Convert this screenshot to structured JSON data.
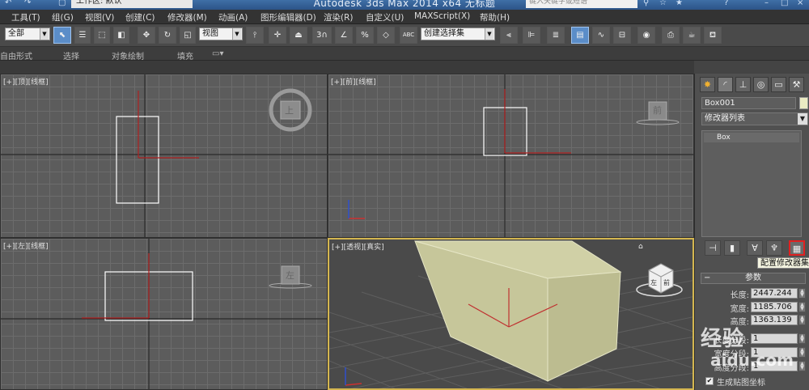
{
  "title_bar": {
    "title": "Autodesk 3ds Max  2014 x64     无标题",
    "workspace": "工作区: 默认",
    "search_placeholder": "键入关键字或短语"
  },
  "menu": [
    "工具(T)",
    "组(G)",
    "视图(V)",
    "创建(C)",
    "修改器(M)",
    "动画(A)",
    "图形编辑器(D)",
    "渲染(R)",
    "自定义(U)",
    "MAXScript(X)",
    "帮助(H)"
  ],
  "toolbar": {
    "selection_filter": "全部",
    "reference_coord": "视图",
    "named_selection": "创建选择集",
    "snap_3": "3",
    "angle_snap": "∠",
    "percent_snap": "%",
    "spinner_snap": "◇",
    "abc": "ABC"
  },
  "ribbon": {
    "items": [
      "自由形式",
      "选择",
      "对象绘制",
      "填充"
    ]
  },
  "viewports": {
    "top_left": {
      "label": "[+][顶][线框]"
    },
    "top_right": {
      "label": "[+][前][线框]"
    },
    "bottom_left": {
      "label": "[+][左][线框]"
    },
    "bottom_right": {
      "label": "[+][透视][真实]"
    },
    "viewcube_top": "上",
    "viewcube_front": "前",
    "viewcube_left": "左",
    "viewcube_persp_left": "左",
    "viewcube_persp_front": "前"
  },
  "command_panel": {
    "object_name": "Box001",
    "modifier_list": "修改器列表",
    "stack_item": "Box",
    "tooltip": "配置修改器集",
    "rollout_title": "参数",
    "params": [
      {
        "label": "长度:",
        "value": "2447.244"
      },
      {
        "label": "宽度:",
        "value": "1185.706"
      },
      {
        "label": "高度:",
        "value": "1363.139"
      },
      {
        "label": "长度分段:",
        "value": "1"
      },
      {
        "label": "宽度分段:",
        "value": "1"
      },
      {
        "label": "高度分段:",
        "value": "1"
      }
    ],
    "generate_mapping": "生成贴图坐标",
    "object_color": "#EAEAC2"
  },
  "watermark": {
    "line1": "经验",
    "line2": "aidu.com"
  },
  "colors": {
    "title_bar": "#2C5488",
    "viewport_bg": "#5C5C5C",
    "active_border": "#D4B650",
    "box_face": "#D8D8B0",
    "highlight": "#E02020"
  }
}
